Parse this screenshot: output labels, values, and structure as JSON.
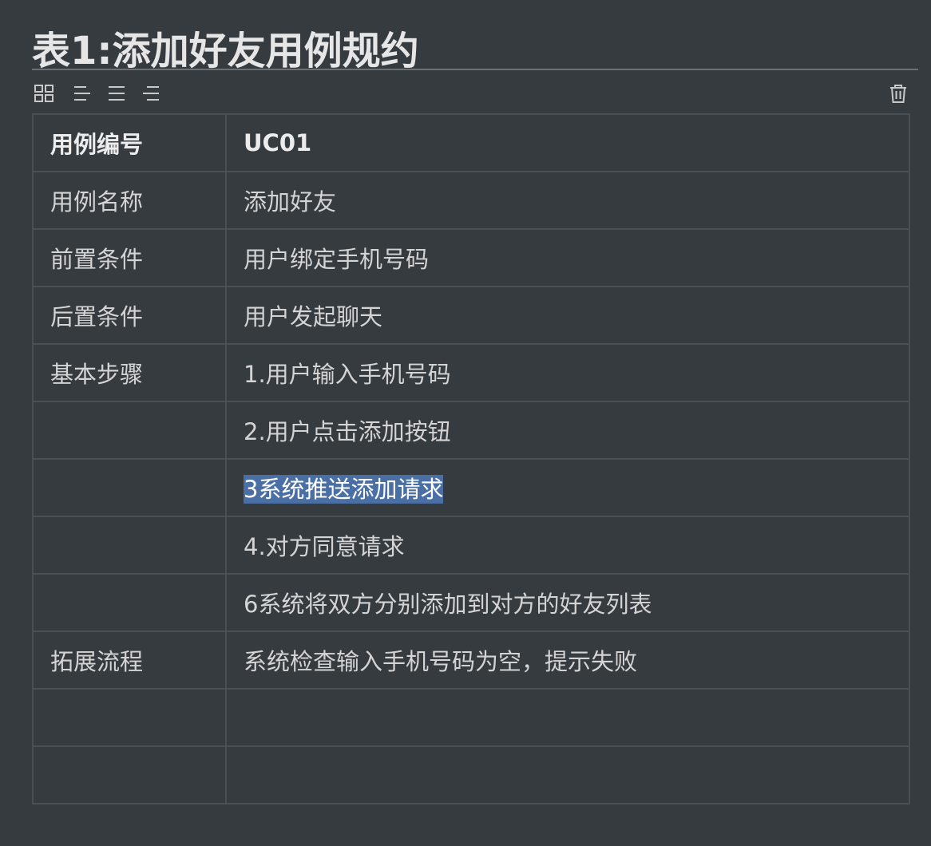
{
  "heading": "表1:添加好友用例规约",
  "toolbar": {
    "icons": [
      "table-grid-icon",
      "align-left-icon",
      "align-center-icon",
      "align-right-icon",
      "trash-icon"
    ]
  },
  "table": {
    "header": {
      "label": "用例编号",
      "value": "UC01"
    },
    "rows": [
      {
        "label": "用例名称",
        "value": "添加好友"
      },
      {
        "label": "前置条件",
        "value": "用户绑定手机号码"
      },
      {
        "label": "后置条件",
        "value": "用户发起聊天"
      },
      {
        "label": "基本步骤",
        "value": "1.用户输入手机号码"
      },
      {
        "label": "",
        "value": "2.用户点击添加按钮"
      },
      {
        "label": "",
        "value": "3系统推送添加请求"
      },
      {
        "label": "",
        "value": "4.对方同意请求"
      },
      {
        "label": "",
        "value": "6系统将双方分别添加到对方的好友列表"
      },
      {
        "label": "拓展流程",
        "value": "系统检查输入手机号码为空，提示失败"
      },
      {
        "label": "",
        "value": ""
      },
      {
        "label": "",
        "value": ""
      }
    ]
  },
  "selection": {
    "selected_text": "3系统推送添加请求",
    "color": "#4a6fa5"
  }
}
